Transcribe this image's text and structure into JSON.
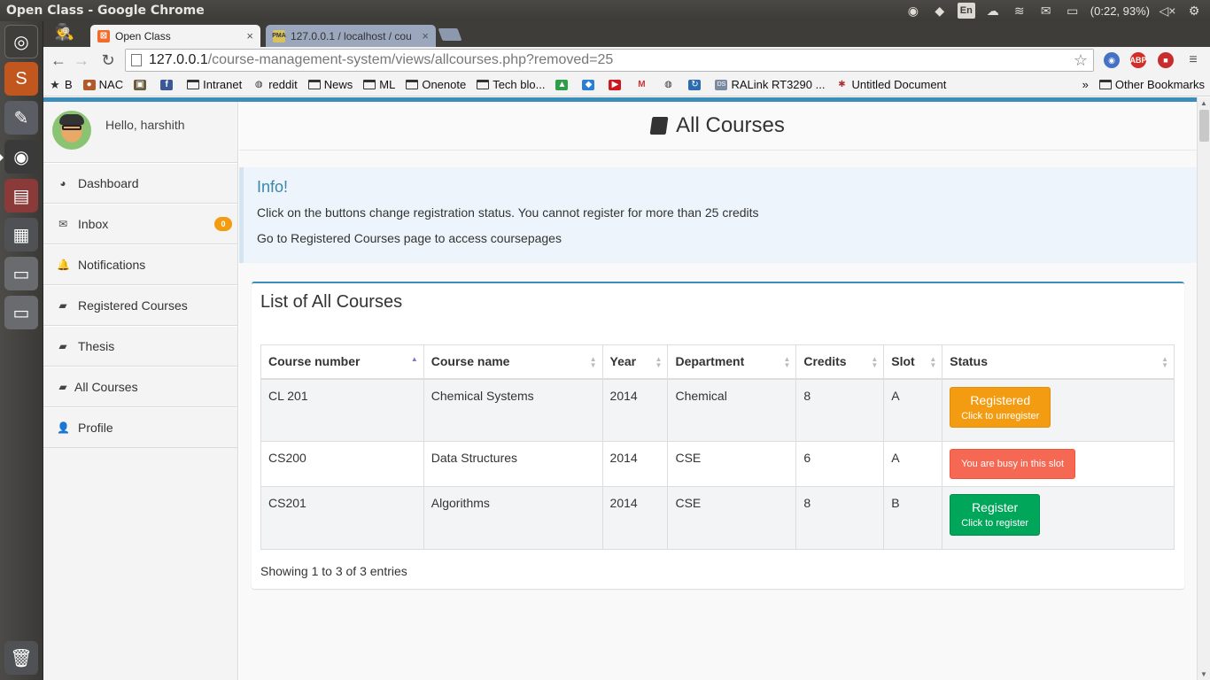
{
  "os": {
    "window_title": "Open Class - Google Chrome",
    "lang": "En",
    "battery": "(0:22, 93%)"
  },
  "browser": {
    "tabs": [
      {
        "title": "Open Class",
        "favicon": "xampp-icon"
      },
      {
        "title": "127.0.0.1 / localhost / cou",
        "favicon": "phpmyadmin-icon"
      }
    ],
    "url_host": "127.0.0.1",
    "url_path": "/course-management-system/views/allcourses.php?removed=25",
    "ext_abp": "ABP",
    "bookmarks": [
      {
        "label": "B",
        "icon": "star-icon"
      },
      {
        "label": "NAC",
        "icon": "nac-icon"
      },
      {
        "label": "",
        "icon": "site-icon"
      },
      {
        "label": "",
        "icon": "facebook-icon"
      },
      {
        "label": "Intranet",
        "icon": "folder-icon"
      },
      {
        "label": "reddit",
        "icon": "reddit-icon"
      },
      {
        "label": "News",
        "icon": "folder-icon"
      },
      {
        "label": "ML",
        "icon": "folder-icon"
      },
      {
        "label": "Onenote",
        "icon": "folder-icon"
      },
      {
        "label": "Tech blo...",
        "icon": "folder-icon"
      },
      {
        "label": "",
        "icon": "drive-icon"
      },
      {
        "label": "",
        "icon": "dropbox-icon"
      },
      {
        "label": "",
        "icon": "youtube-icon"
      },
      {
        "label": "",
        "icon": "gmail-icon"
      },
      {
        "label": "",
        "icon": "reddit-icon"
      },
      {
        "label": "",
        "icon": "refresh-site-icon"
      },
      {
        "label": "RALink RT3290 ...",
        "icon": "ds-icon"
      },
      {
        "label": "Untitled Document",
        "icon": "site-icon"
      }
    ],
    "bookmarks_chevron": "»",
    "other_bookmarks": "Other Bookmarks"
  },
  "sidebar": {
    "greeting": "Hello, harshith",
    "items": [
      {
        "label": "Dashboard",
        "icon": "dashboard-icon"
      },
      {
        "label": "Inbox",
        "icon": "envelope-icon",
        "badge": "0"
      },
      {
        "label": "Notifications",
        "icon": "bell-icon"
      },
      {
        "label": "Registered Courses",
        "icon": "book-icon"
      },
      {
        "label": "Thesis",
        "icon": "book-icon"
      },
      {
        "label": "All Courses",
        "icon": "book-icon"
      },
      {
        "label": "Profile",
        "icon": "user-icon"
      }
    ]
  },
  "header": {
    "title": "All Courses"
  },
  "callout": {
    "title": "Info!",
    "line1": "Click on the buttons change registration status. You cannot register for more than 25 credits",
    "line2": "Go to Registered Courses page to access coursepages"
  },
  "box": {
    "title": "List of All Courses",
    "columns": [
      "Course number",
      "Course name",
      "Year",
      "Department",
      "Credits",
      "Slot",
      "Status"
    ],
    "rows": [
      {
        "number": "CL 201",
        "name": "Chemical Systems",
        "year": "2014",
        "department": "Chemical",
        "credits": "8",
        "slot": "A",
        "status_main": "Registered",
        "status_sub": "Click to unregister",
        "status_type": "registered"
      },
      {
        "number": "CS200",
        "name": "Data Structures",
        "year": "2014",
        "department": "CSE",
        "credits": "6",
        "slot": "A",
        "status_main": "You are busy in this slot",
        "status_sub": "",
        "status_type": "busy"
      },
      {
        "number": "CS201",
        "name": "Algorithms",
        "year": "2014",
        "department": "CSE",
        "credits": "8",
        "slot": "B",
        "status_main": "Register",
        "status_sub": "Click to register",
        "status_type": "register"
      }
    ],
    "info": "Showing 1 to 3 of 3 entries"
  },
  "colors": {
    "accent": "#3c8dbc",
    "registered": "#f39c12",
    "busy": "#f56954",
    "register": "#00a65a"
  }
}
